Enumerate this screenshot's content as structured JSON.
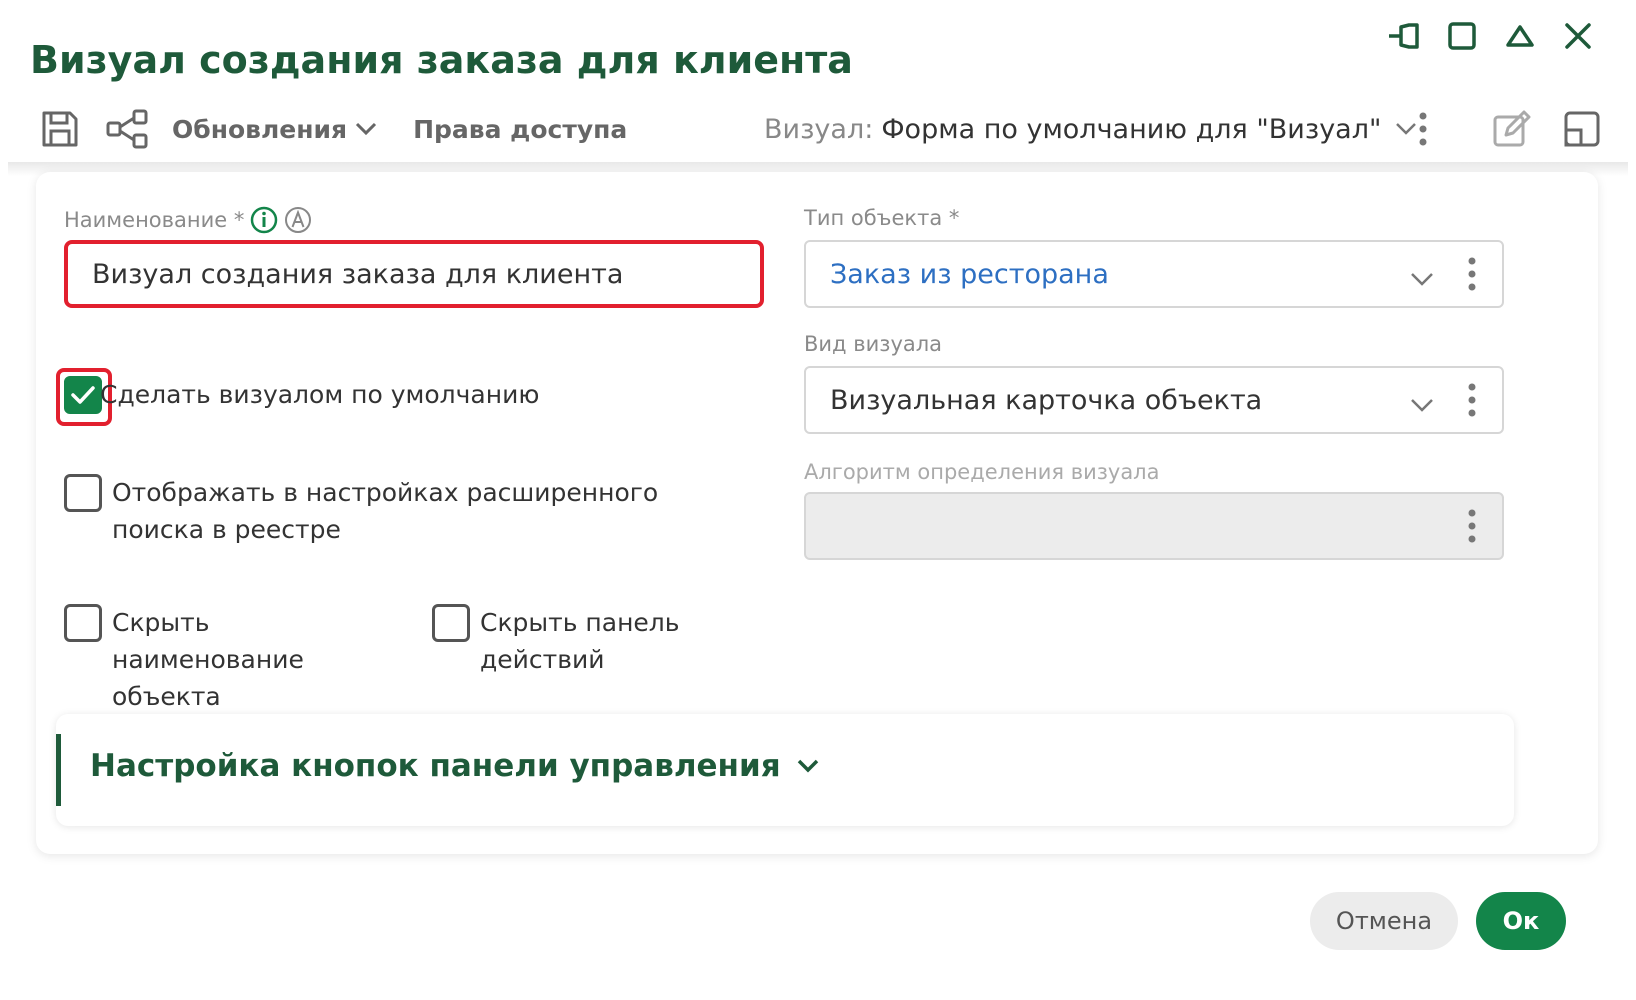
{
  "window": {
    "title": "Визуал создания заказа для клиента",
    "controls": [
      "pin-icon",
      "maximize-icon",
      "collapse-icon",
      "close-icon"
    ]
  },
  "toolbar": {
    "save_icon": "save-icon",
    "relations_icon": "share-nodes-icon",
    "updates_label": "Обновления",
    "access_label": "Права доступа",
    "visual_label": "Визуал:",
    "visual_value": "Форма по умолчанию для \"Визуал\"",
    "right_icons": [
      "edit-icon",
      "layout-icon"
    ]
  },
  "form": {
    "name": {
      "label": "Наименование *",
      "value": "Визуал создания заказа для клиента"
    },
    "default_visual": {
      "label": "Сделать визуалом по умолчанию",
      "checked": true
    },
    "advanced_search": {
      "label": "Отображать в настройках расширенного поиска в реестре",
      "checked": false
    },
    "hide_name": {
      "label": "Скрыть наименование объекта",
      "checked": false
    },
    "hide_panel": {
      "label": "Скрыть панель действий",
      "checked": false
    },
    "object_type": {
      "label": "Тип объекта *",
      "value": "Заказ из ресторана"
    },
    "visual_kind": {
      "label": "Вид визуала",
      "value": "Визуальная карточка объекта"
    },
    "algorithm": {
      "label": "Алгоритм определения визуала",
      "value": ""
    }
  },
  "section": {
    "title": "Настройка кнопок панели управления"
  },
  "actions": {
    "cancel": "Отмена",
    "ok": "Ок"
  },
  "colors": {
    "accent": "#13854a",
    "title": "#1e5a3a",
    "highlight": "#e2202e",
    "link": "#2d6fc2"
  }
}
